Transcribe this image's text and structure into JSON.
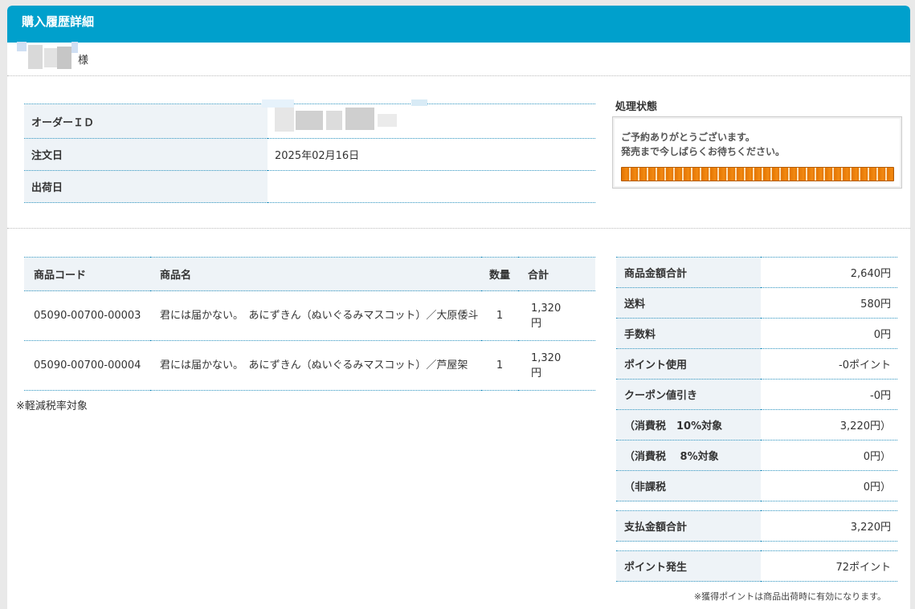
{
  "header": {
    "title": "購入履歴詳細"
  },
  "customer": {
    "suffix": "様"
  },
  "order_info": {
    "rows": [
      {
        "label": "オーダーＩＤ",
        "value": ""
      },
      {
        "label": "注文日",
        "value": "2025年02月16日"
      },
      {
        "label": "出荷日",
        "value": ""
      }
    ]
  },
  "status": {
    "title": "処理状態",
    "line1": "ご予約ありがとうございます。",
    "line2": "発売まで今しばらくお待ちください。",
    "progress": 1.0,
    "progress_color": "#e37400"
  },
  "products": {
    "headers": {
      "code": "商品コード",
      "name": "商品名",
      "qty": "数量",
      "total": "合計"
    },
    "rows": [
      {
        "code": "05090-00700-00003",
        "name": "君には届かない。　あにずきん（ぬいぐるみマスコット）／大原倭斗",
        "qty": "1",
        "total": "1,320円"
      },
      {
        "code": "05090-00700-00004",
        "name": "君には届かない。　あにずきん（ぬいぐるみマスコット）／芦屋架",
        "qty": "1",
        "total": "1,320円"
      }
    ],
    "note": "※軽減税率対象"
  },
  "summary": {
    "rows": [
      {
        "label": "商品金額合計",
        "value": "2,640円"
      },
      {
        "label": "送料",
        "value": "580円"
      },
      {
        "label": "手数料",
        "value": "0円"
      },
      {
        "label": "ポイント使用",
        "value": "-0ポイント"
      },
      {
        "label": "クーポン値引き",
        "value": "-0円"
      },
      {
        "label": "（消費税　10%対象",
        "value": "3,220円）"
      },
      {
        "label": "（消費税　 8%対象",
        "value": "0円）"
      },
      {
        "label": "（非課税",
        "value": "0円）"
      }
    ],
    "payment_total": {
      "label": "支払金額合計",
      "value": "3,220円"
    },
    "points_earned": {
      "label": "ポイント発生",
      "value": "72ポイント"
    },
    "points_note": "※獲得ポイントは商品出荷時に有効になります。"
  },
  "colors": {
    "header": "#00a0cc",
    "row_label_bg": "#eef3f7",
    "border": "#2b93bf"
  }
}
